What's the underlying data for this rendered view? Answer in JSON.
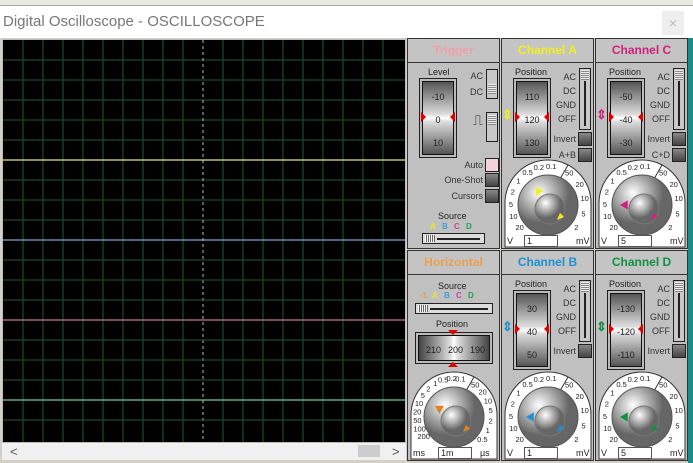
{
  "window": {
    "title": "Digital Oscilloscope - OSCILLOSCOPE",
    "close": "×"
  },
  "screen": {
    "traces": [
      {
        "channel": "A",
        "color": "#e8e878",
        "level_div": -4
      },
      {
        "channel": "B",
        "color": "#78a8d0",
        "level_div": 0
      },
      {
        "channel": "C",
        "color": "#c87888",
        "level_div": 4
      },
      {
        "channel": "D",
        "color": "#70c890",
        "level_div": 8
      }
    ],
    "grid_color": "#1f5a2a"
  },
  "scrollbar": {
    "left": "<",
    "right": ">"
  },
  "trigger": {
    "title": "Trigger",
    "title_color": "#f0a0a8",
    "level_label": "Level",
    "drum": [
      "-10",
      "0",
      "10"
    ],
    "ac": "AC",
    "dc": "DC",
    "auto": "Auto",
    "one_shot": "One-Shot",
    "cursors": "Cursors",
    "source_label": "Source",
    "sources": [
      {
        "l": "A",
        "c": "#e8e820"
      },
      {
        "l": "B",
        "c": "#3aa0d8"
      },
      {
        "l": "C",
        "c": "#d040a0"
      },
      {
        "l": "D",
        "c": "#20a050"
      }
    ]
  },
  "horizontal": {
    "title": "Horizontal",
    "title_color": "#e8a050",
    "source_label": "Source",
    "sources": [
      {
        "l": "-1",
        "c": "#e8a050"
      },
      {
        "l": "A",
        "c": "#e8e820"
      },
      {
        "l": "B",
        "c": "#3aa0d8"
      },
      {
        "l": "C",
        "c": "#d040a0"
      },
      {
        "l": "D",
        "c": "#20a050"
      }
    ],
    "position_label": "Position",
    "drum": [
      "210",
      "200",
      "190"
    ],
    "scale_left": [
      "200",
      "100",
      "50",
      "20",
      "10",
      "5",
      "2",
      "1",
      "0.5",
      "0.2",
      "0.1"
    ],
    "scale_right": [
      "50",
      "20",
      "10",
      "5",
      "2",
      "1",
      "0.5"
    ],
    "unit_left": "ms",
    "unit_right": "µs",
    "value": "1m",
    "color": "#e08020"
  },
  "channels": [
    {
      "id": "A",
      "title": "Channel A",
      "color": "#f0f020",
      "drum": [
        "110",
        "120",
        "130"
      ],
      "value": "1",
      "extra": "A+B"
    },
    {
      "id": "C",
      "title": "Channel C",
      "color": "#d02080",
      "drum": [
        "-50",
        "-40",
        "-30"
      ],
      "value": "5",
      "extra": "C+D"
    },
    {
      "id": "B",
      "title": "Channel B",
      "color": "#2090d0",
      "drum": [
        "30",
        "40",
        "50"
      ],
      "value": "1"
    },
    {
      "id": "D",
      "title": "Channel D",
      "color": "#109040",
      "drum": [
        "-130",
        "-120",
        "-110"
      ],
      "value": "5"
    }
  ],
  "channel_common": {
    "position_label": "Position",
    "ac": "AC",
    "dc": "DC",
    "gnd": "GND",
    "off": "OFF",
    "invert": "Invert",
    "scale_left": [
      "20",
      "10",
      "5",
      "2",
      "1",
      "0.5",
      "0.2",
      "0.1"
    ],
    "scale_right": [
      "50",
      "20",
      "10",
      "5",
      "2"
    ],
    "unit_left": "V",
    "unit_right": "mV"
  }
}
